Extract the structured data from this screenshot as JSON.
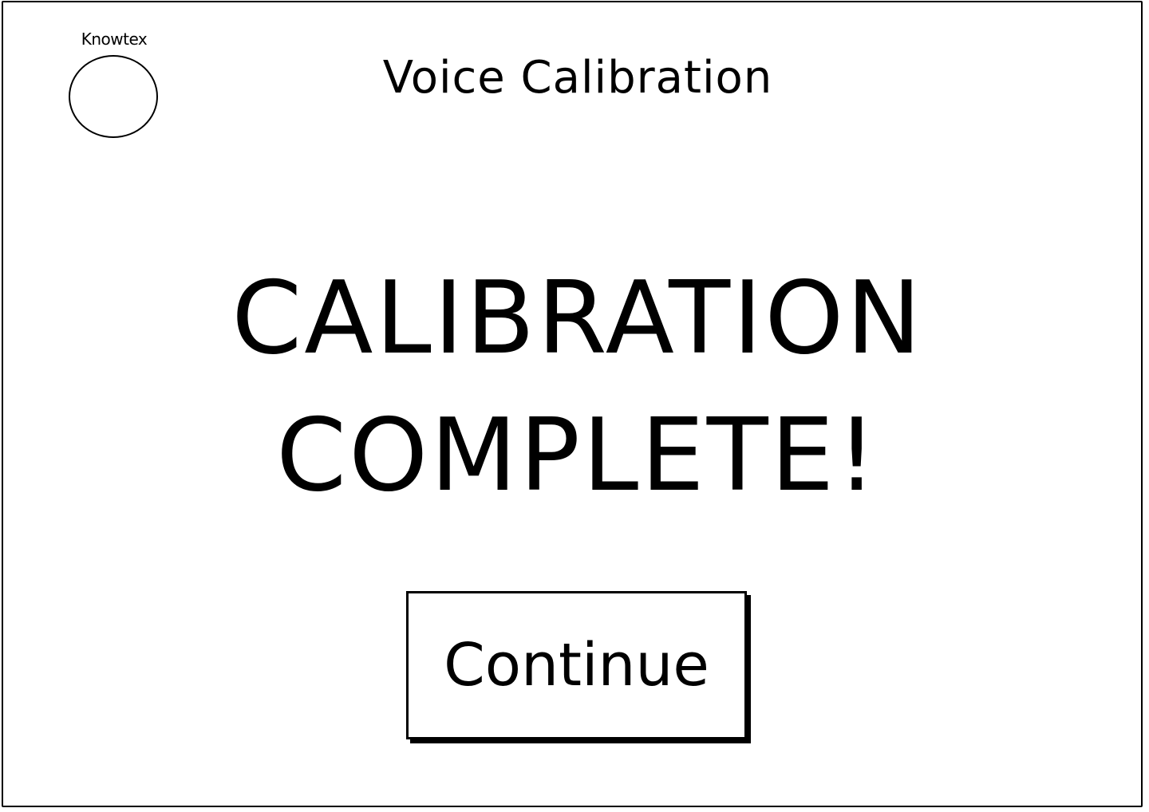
{
  "logo": {
    "label": "Knowtex"
  },
  "header": {
    "title": "Voice Calibration"
  },
  "main": {
    "message_line1": "CALIBRATION",
    "message_line2": "COMPLETE!",
    "continue_label": "Continue"
  }
}
